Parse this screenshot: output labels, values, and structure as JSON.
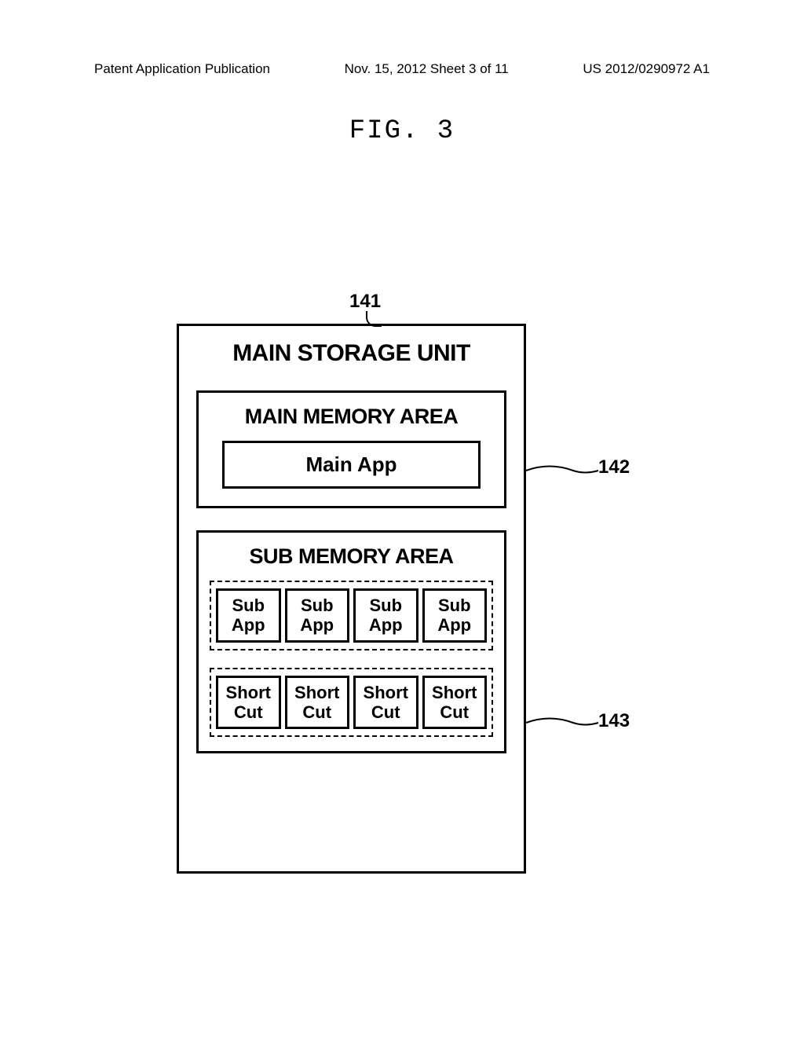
{
  "header": {
    "left": "Patent Application Publication",
    "center": "Nov. 15, 2012  Sheet 3 of 11",
    "right": "US 2012/0290972 A1"
  },
  "figure": {
    "title": "FIG. 3"
  },
  "references": {
    "ref141": "141",
    "ref142": "142",
    "ref143": "143"
  },
  "diagram": {
    "mainTitle": "MAIN STORAGE UNIT",
    "mainMemory": {
      "title": "MAIN MEMORY AREA",
      "app": "Main App"
    },
    "subMemory": {
      "title": "SUB MEMORY AREA",
      "subApps": [
        "Sub App",
        "Sub App",
        "Sub App",
        "Sub App"
      ],
      "shortcuts": [
        "Short Cut",
        "Short Cut",
        "Short Cut",
        "Short Cut"
      ]
    }
  }
}
